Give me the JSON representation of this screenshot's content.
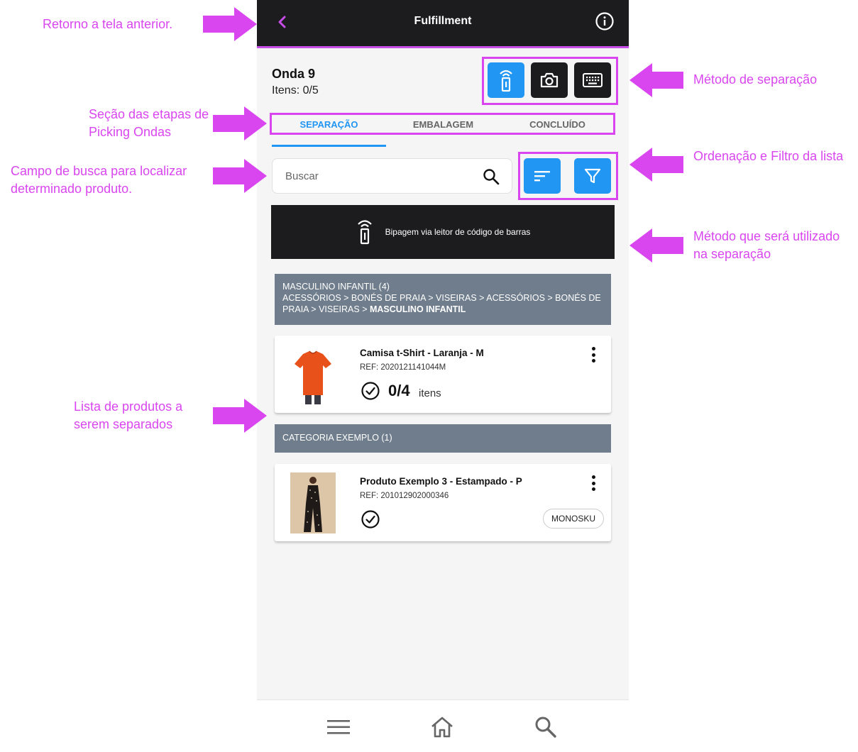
{
  "app": {
    "title": "Fulfillment",
    "accent_color": "#c84de8",
    "primary_color": "#2196f3",
    "appbar_color": "#1c1c1e"
  },
  "icons": {
    "back": "chevron-left-icon",
    "info": "info-icon",
    "scanner": "barcode-scanner-icon",
    "camera": "camera-icon",
    "keyboard": "keyboard-icon",
    "search": "search-icon",
    "sort": "sort-icon",
    "filter": "filter-icon",
    "check": "check-circle-icon",
    "more": "more-vertical-icon",
    "menu": "menu-icon",
    "home": "home-icon"
  },
  "wave": {
    "title": "Onda 9",
    "items": "Itens: 0/5"
  },
  "tabs": [
    {
      "label": "SEPARAÇÃO",
      "active": true
    },
    {
      "label": "EMBALAGEM",
      "active": false
    },
    {
      "label": "CONCLUÍDO",
      "active": false
    }
  ],
  "search": {
    "placeholder": "Buscar",
    "value": ""
  },
  "method_banner": {
    "text": "Bipagem via leitor de código de barras"
  },
  "categories": [
    {
      "title": "MASCULINO INFANTIL (4)",
      "path": "ACESSÓRIOS > BONÉS DE PRAIA > VISEIRAS > ACESSÓRIOS > BONÉS DE PRAIA > VISEIRAS > ",
      "path_bold": "MASCULINO INFANTIL"
    },
    {
      "title": "CATEGORIA EXEMPLO (1)"
    }
  ],
  "products": [
    {
      "name": "Camisa t-Shirt  - Laranja - M",
      "ref": "REF: 2020121141044M",
      "qty": "0/4",
      "unit": "itens"
    },
    {
      "name": "Produto Exemplo 3  - Estampado - P",
      "ref": "REF: 201012902000346",
      "badge": "MONOSKU"
    }
  ],
  "annotations": {
    "back": "Retorno a tela anterior.",
    "method": "Método de separação",
    "tabs": "Seção das etapas de Picking Ondas",
    "sort_filter": "Ordenação e Filtro da lista",
    "search": "Campo de busca para localizar determinado produto.",
    "banner": "Método que será utilizado na separação",
    "list": "Lista de produtos a serem separados",
    "color": "#d946ef"
  }
}
